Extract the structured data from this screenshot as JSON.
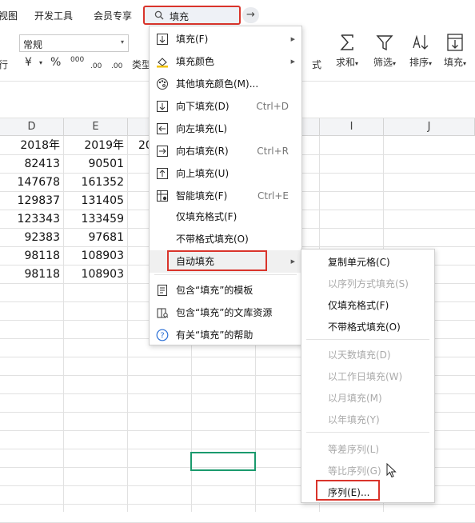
{
  "tabs": [
    "视图",
    "开发工具",
    "会员专享"
  ],
  "search": {
    "query": "填充",
    "go_icon": "arrow-right-icon"
  },
  "ribbon": {
    "number_format": "常规",
    "left_label": "行",
    "currency": "¥",
    "percent": "%",
    "thousands": "000",
    "inc_decimal": ".00",
    "dec_decimal": ".00",
    "type_label": "类型",
    "border_label": "式",
    "sum_label": "求和",
    "filter_label": "筛选",
    "sort_label": "排序",
    "fill_label": "填充",
    "dropdown_caret": "▾"
  },
  "sheet": {
    "columns": [
      {
        "name": "D"
      },
      {
        "name": "E"
      },
      {
        "name": "F"
      },
      {
        "name": "G"
      },
      {
        "name": "H"
      },
      {
        "name": "I"
      },
      {
        "name": "J"
      }
    ],
    "rows": [
      [
        "2018年",
        "2019年",
        "20"
      ],
      [
        "82413",
        "90501",
        ""
      ],
      [
        "147678",
        "161352",
        ""
      ],
      [
        "129837",
        "131405",
        ""
      ],
      [
        "123343",
        "133459",
        ""
      ],
      [
        "92383",
        "97681",
        ""
      ],
      [
        "98118",
        "108903",
        ""
      ],
      [
        "98118",
        "108903",
        ""
      ]
    ]
  },
  "fill_menu": {
    "items": [
      {
        "label": "填充(F)",
        "icon": "fill-down-icon",
        "shortcut": "",
        "submenu": true
      },
      {
        "label": "填充颜色",
        "icon": "paint-bucket-icon",
        "shortcut": "",
        "submenu": true
      },
      {
        "label": "其他填充颜色(M)...",
        "icon": "palette-icon",
        "shortcut": "",
        "submenu": false
      },
      {
        "label": "向下填充(D)",
        "icon": "fill-down-icon",
        "shortcut": "Ctrl+D",
        "submenu": false
      },
      {
        "label": "向左填充(L)",
        "icon": "fill-left-icon",
        "shortcut": "",
        "submenu": false
      },
      {
        "label": "向右填充(R)",
        "icon": "fill-right-icon",
        "shortcut": "Ctrl+R",
        "submenu": false
      },
      {
        "label": "向上填充(U)",
        "icon": "fill-up-icon",
        "shortcut": "",
        "submenu": false
      },
      {
        "label": "智能填充(F)",
        "icon": "smart-fill-icon",
        "shortcut": "Ctrl+E",
        "submenu": false
      },
      {
        "label": "仅填充格式(F)",
        "icon": "",
        "shortcut": "",
        "submenu": false
      },
      {
        "label": "不带格式填充(O)",
        "icon": "",
        "shortcut": "",
        "submenu": false
      },
      {
        "label": "自动填充",
        "icon": "",
        "shortcut": "",
        "submenu": true
      },
      {
        "label": "包含“填充”的模板",
        "icon": "template-icon",
        "shortcut": "",
        "submenu": false
      },
      {
        "label": "包含“填充”的文库资源",
        "icon": "library-icon",
        "shortcut": "",
        "submenu": false
      },
      {
        "label": "有关“填充”的帮助",
        "icon": "help-icon",
        "shortcut": "",
        "submenu": false
      }
    ]
  },
  "autofill_menu": {
    "items": [
      {
        "label": "复制单元格(C)",
        "disabled": false
      },
      {
        "label": "以序列方式填充(S)",
        "disabled": true
      },
      {
        "label": "仅填充格式(F)",
        "disabled": false
      },
      {
        "label": "不带格式填充(O)",
        "disabled": false
      },
      {
        "label": "以天数填充(D)",
        "disabled": true
      },
      {
        "label": "以工作日填充(W)",
        "disabled": true
      },
      {
        "label": "以月填充(M)",
        "disabled": true
      },
      {
        "label": "以年填充(Y)",
        "disabled": true
      },
      {
        "label": "等差序列(L)",
        "disabled": true
      },
      {
        "label": "等比序列(G)",
        "disabled": true
      },
      {
        "label": "序列(E)...",
        "disabled": false
      }
    ]
  },
  "colors": {
    "highlight": "#d9342b",
    "selection": "#1b9a6d"
  }
}
